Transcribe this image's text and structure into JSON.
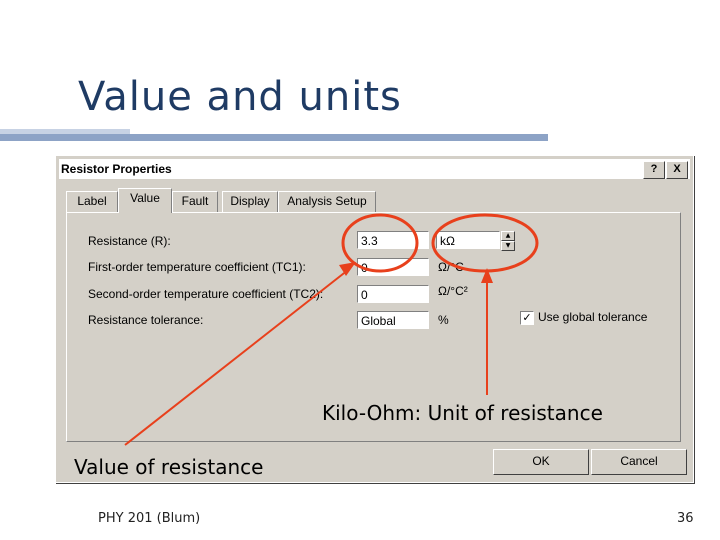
{
  "slide": {
    "title": "Value and units",
    "annotation_unit": "Kilo-Ohm: Unit of resistance",
    "annotation_value": "Value of resistance",
    "footer_left": "PHY 201 (Blum)",
    "page_number": "36",
    "accent_color": "#1f3b64",
    "highlight_color": "#e8401c"
  },
  "dialog": {
    "title": "Resistor Properties",
    "help_button": "?",
    "close_button": "X",
    "tabs": [
      {
        "label": "Label"
      },
      {
        "label": "Value",
        "active": true
      },
      {
        "label": "Fault"
      },
      {
        "label": "Display"
      },
      {
        "label": "Analysis Setup"
      }
    ],
    "fields": {
      "resistance_label": "Resistance (R):",
      "resistance_value": "3.3",
      "resistance_unit": "kΩ",
      "tc1_label": "First-order temperature coefficient (TC1):",
      "tc1_value": "0",
      "tc1_unit": "Ω/°C",
      "tc2_label": "Second-order temperature coefficient (TC2):",
      "tc2_value": "0",
      "tc2_unit": "Ω/°C²",
      "tolerance_label": "Resistance tolerance:",
      "tolerance_value": "Global",
      "tolerance_unit": "%",
      "global_tolerance_label": "Use global tolerance",
      "global_tolerance_checked": true
    },
    "buttons": {
      "ok": "OK",
      "cancel": "Cancel"
    }
  }
}
